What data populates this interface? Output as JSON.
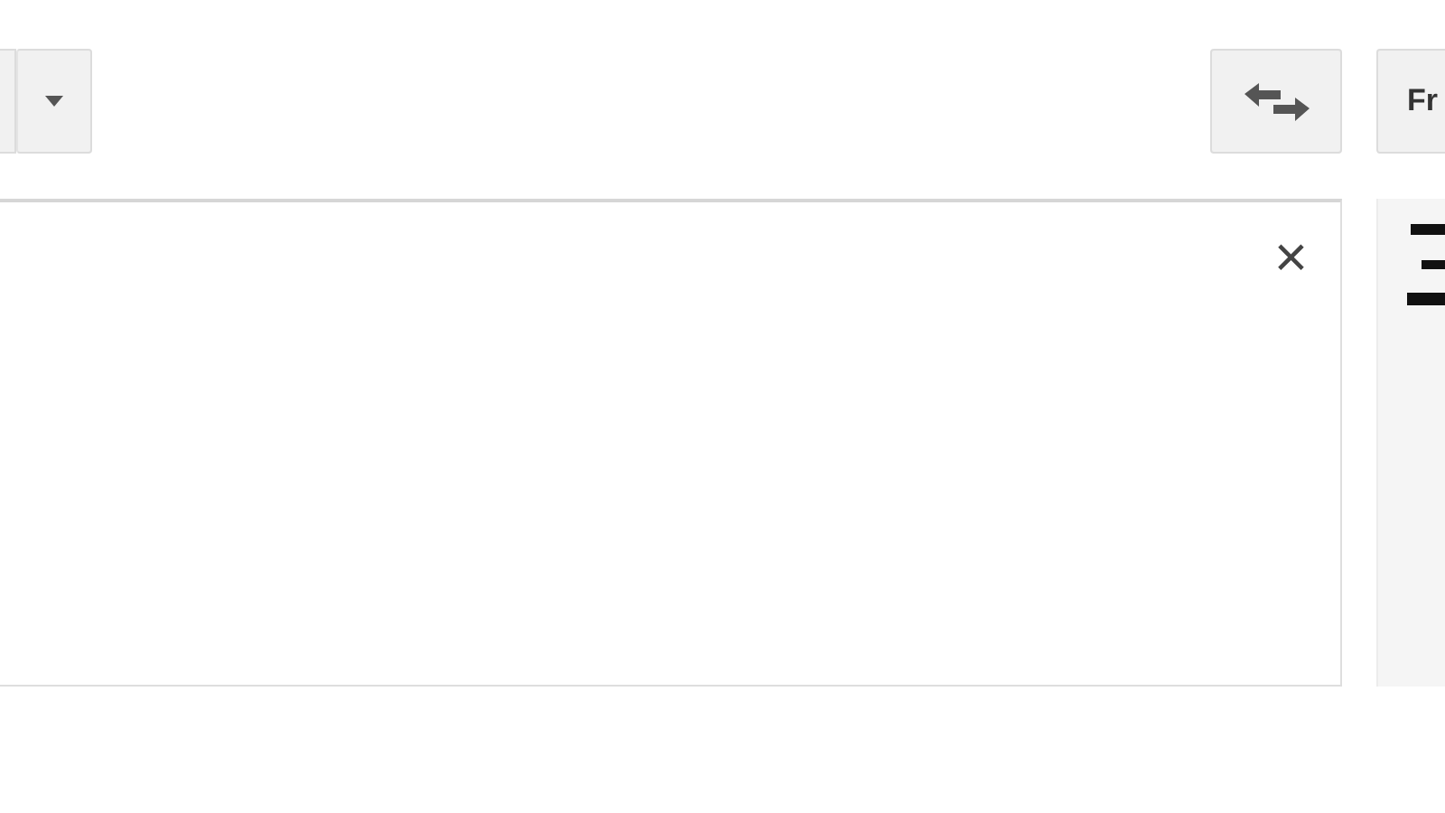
{
  "source_language_menu": {
    "expanded": false
  },
  "swap_button": {
    "disabled": false
  },
  "target_language_button": {
    "label": "Fr"
  },
  "source_input": {
    "clear_button": {
      "label": "×"
    }
  }
}
